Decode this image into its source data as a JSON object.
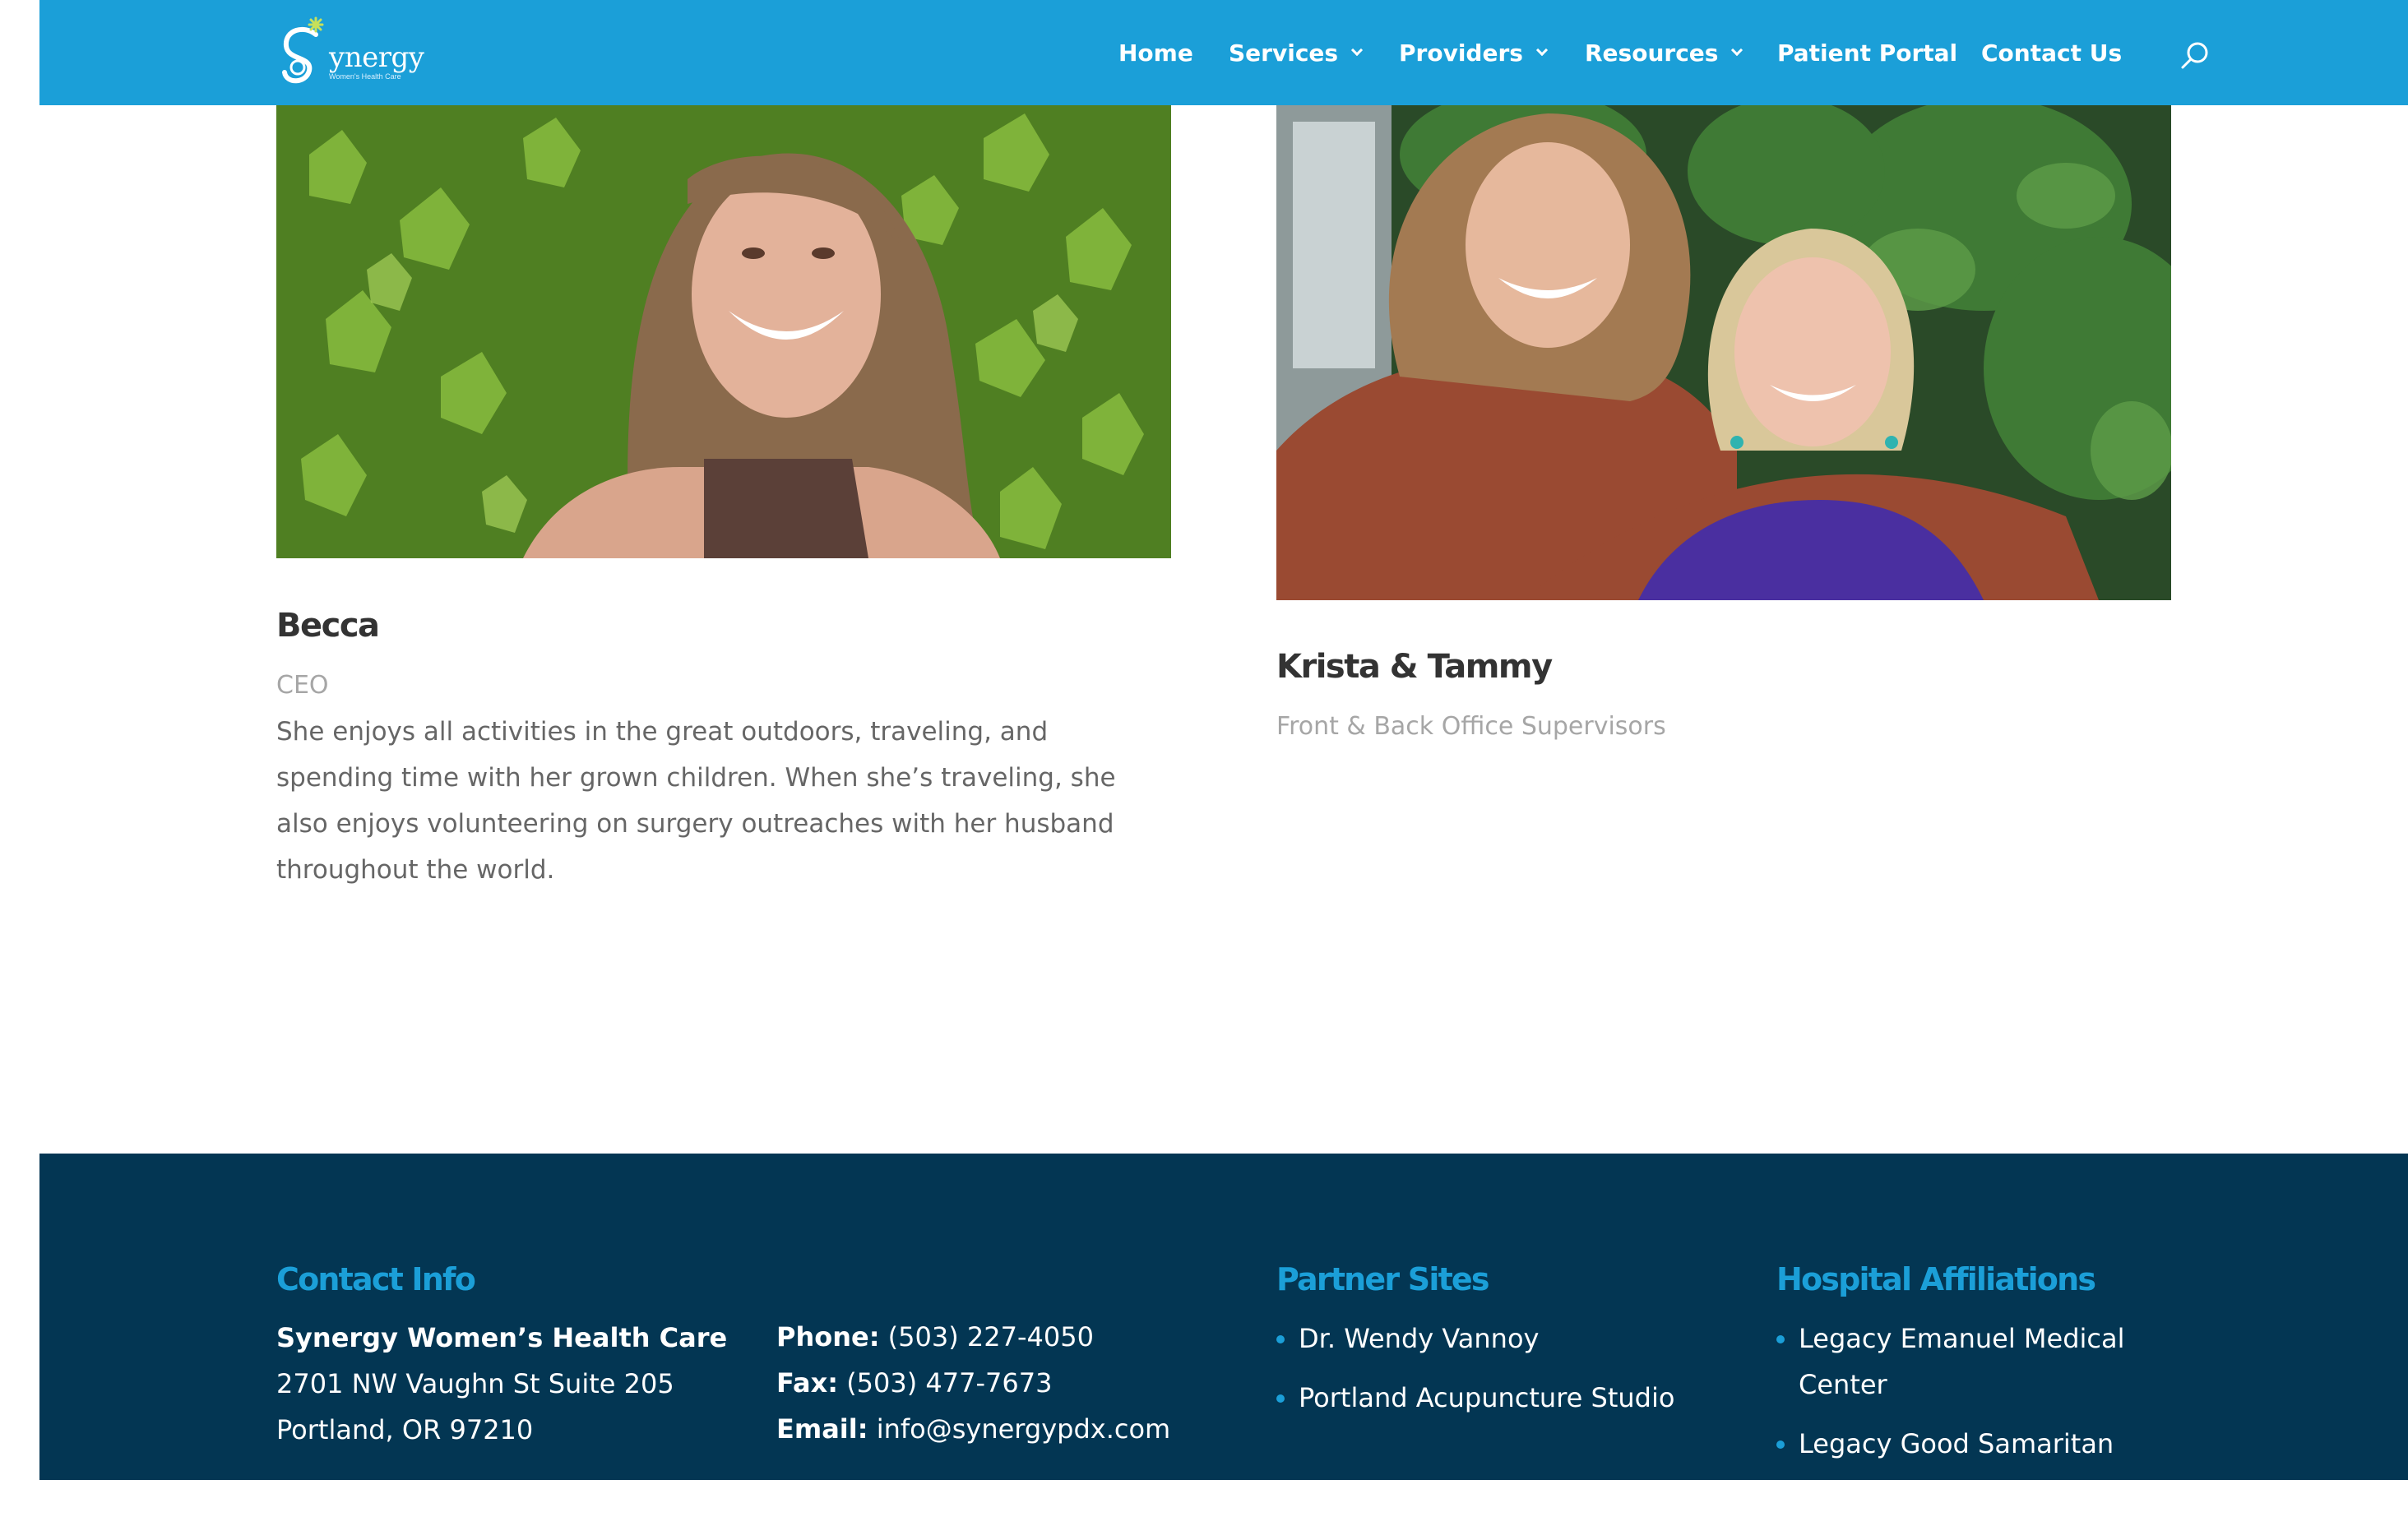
{
  "site": {
    "logo_name": "ynergy",
    "logo_initial": "S",
    "logo_tagline": "Women's Health Care"
  },
  "nav": {
    "items": [
      {
        "label": "Home",
        "has_dropdown": false
      },
      {
        "label": "Services",
        "has_dropdown": true
      },
      {
        "label": "Providers",
        "has_dropdown": true
      },
      {
        "label": "Resources",
        "has_dropdown": true
      },
      {
        "label": "Patient Portal",
        "has_dropdown": false
      },
      {
        "label": "Contact Us",
        "has_dropdown": false
      }
    ],
    "search_icon": "search-icon"
  },
  "team": [
    {
      "name": "Becca",
      "role": "CEO",
      "bio": "She enjoys all activities in the great outdoors, traveling, and spending time with her grown children. When she’s traveling, she also enjoys volunteering on surgery outreaches with her husband throughout the world."
    },
    {
      "name": "Krista & Tammy",
      "role": "Front & Back Office Supervisors"
    }
  ],
  "footer": {
    "contact": {
      "heading": "Contact Info",
      "org_name": "Synergy Women’s Health Care",
      "address_line1": "2701 NW Vaughn St Suite 205",
      "address_line2": "Portland, OR 97210",
      "phone_label": "Phone:",
      "phone": "(503) 227-4050",
      "fax_label": "Fax:",
      "fax": "(503) 477-7673",
      "email_label": "Email:",
      "email": "info@synergypdx.com"
    },
    "partners": {
      "heading": "Partner Sites",
      "items": [
        "Dr. Wendy Vannoy",
        "Portland Acupuncture Studio"
      ]
    },
    "hospitals": {
      "heading": "Hospital Affiliations",
      "items": [
        "Legacy Emanuel Medical Center",
        "Legacy Good Samaritan"
      ]
    }
  },
  "colors": {
    "header_bg": "#1b9fd8",
    "footer_bg": "#033653",
    "accent": "#1b9fd8"
  }
}
